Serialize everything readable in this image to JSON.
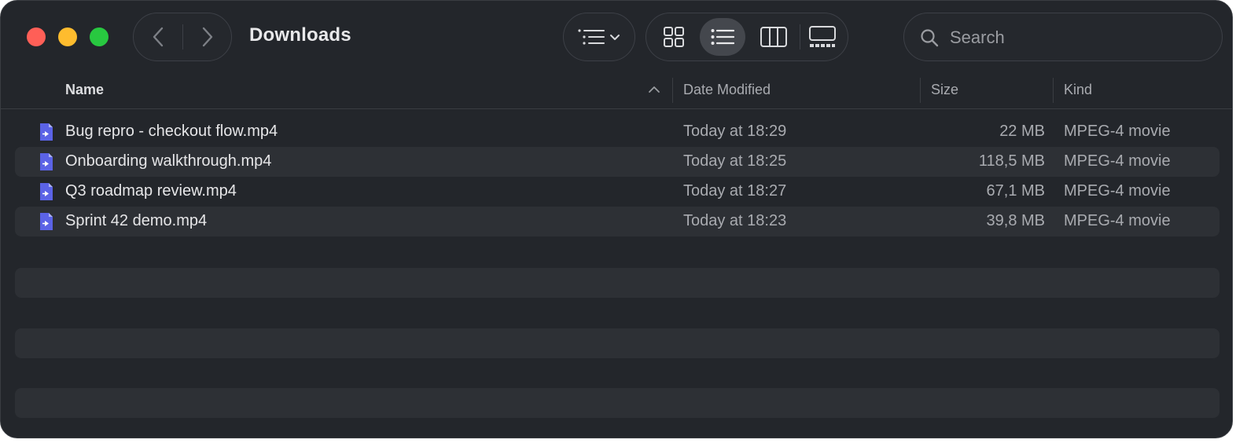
{
  "window": {
    "title": "Downloads"
  },
  "toolbar": {
    "back_icon": "chevron-left-icon",
    "forward_icon": "chevron-right-icon",
    "sort_icon": "list-sort-icon",
    "views": [
      "icon-view-icon",
      "list-view-icon",
      "column-view-icon",
      "gallery-view-icon"
    ],
    "active_view": "list-view-icon"
  },
  "search": {
    "placeholder": "Search",
    "value": ""
  },
  "columns": {
    "name": "Name",
    "date": "Date Modified",
    "size": "Size",
    "kind": "Kind",
    "sorted_by": "Name",
    "sort_direction": "ascending"
  },
  "files": [
    {
      "name": "Bug repro - checkout flow.mp4",
      "date": "Today at 18:29",
      "size": "22 MB",
      "kind": "MPEG-4 movie"
    },
    {
      "name": "Onboarding walkthrough.mp4",
      "date": "Today at 18:25",
      "size": "118,5 MB",
      "kind": "MPEG-4 movie"
    },
    {
      "name": "Q3 roadmap review.mp4",
      "date": "Today at 18:27",
      "size": "67,1 MB",
      "kind": "MPEG-4 movie"
    },
    {
      "name": "Sprint 42 demo.mp4",
      "date": "Today at 18:23",
      "size": "39,8 MB",
      "kind": "MPEG-4 movie"
    }
  ],
  "colors": {
    "window_bg": "#23262b",
    "alt_row": "#2d3035",
    "file_icon": "#5b63e6",
    "close": "#ff5f57",
    "minimize": "#febc2e",
    "zoom": "#28c840"
  }
}
